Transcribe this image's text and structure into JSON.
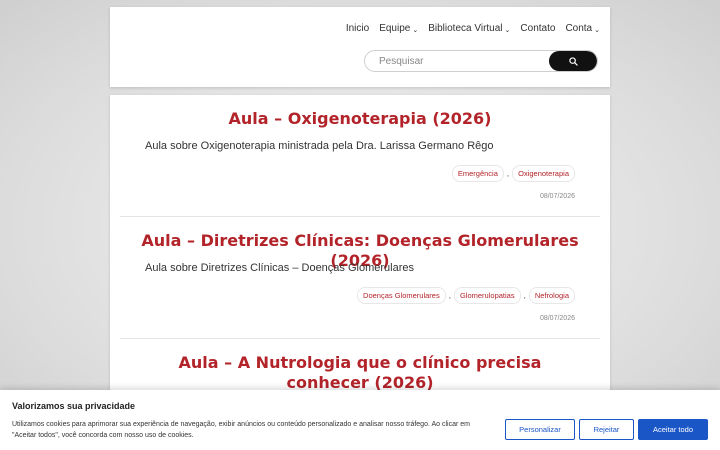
{
  "nav": {
    "items": [
      {
        "label": "Inicio",
        "has_dropdown": false
      },
      {
        "label": "Equipe",
        "has_dropdown": true
      },
      {
        "label": "Biblioteca Virtual",
        "has_dropdown": true
      },
      {
        "label": "Contato",
        "has_dropdown": false
      },
      {
        "label": "Conta",
        "has_dropdown": true
      }
    ]
  },
  "search": {
    "placeholder": "Pesquisar",
    "value": ""
  },
  "posts": [
    {
      "title": "Aula – Oxigenoterapia (2026)",
      "description": "Aula sobre Oxigenoterapia ministrada pela Dra. Larissa Germano Rêgo",
      "tags": [
        "Emergência",
        "Oxigenoterapia"
      ],
      "date": "08/07/2026"
    },
    {
      "title": "Aula – Diretrizes Clínicas: Doenças Glomerulares (2026)",
      "description": "Aula sobre Diretrizes Clínicas – Doenças Glomerulares",
      "tags": [
        "Doenças Glomerulares",
        "Glomerulopatias",
        "Nefrologia"
      ],
      "date": "08/07/2026"
    },
    {
      "title": "Aula – A Nutrologia que o clínico precisa conhecer (2026)"
    }
  ],
  "cookie": {
    "title": "Valorizamos sua privacidade",
    "text": "Utilizamos cookies para aprimorar sua experiência de navegação, exibir anúncios ou conteúdo personalizado e analisar nosso tráfego. Ao clicar em \"Aceitar todos\", você concorda com nosso uso de cookies.",
    "customize_label": "Personalizar",
    "reject_label": "Rejeitar",
    "accept_label": "Aceitar todo"
  },
  "colors": {
    "accent": "#b3242a",
    "button_blue": "#1a56c6",
    "search_button": "#111111"
  }
}
